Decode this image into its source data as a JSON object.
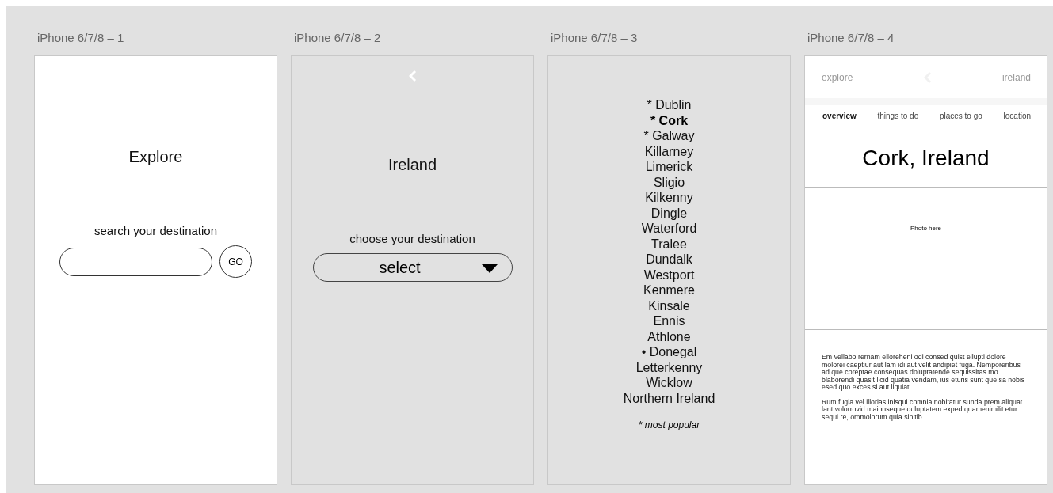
{
  "artboards": [
    {
      "kind": "search",
      "label": "iPhone 6/7/8 – 1",
      "title": "Explore",
      "prompt": "search your destination",
      "button": "GO"
    },
    {
      "kind": "choose",
      "label": "iPhone 6/7/8 – 2",
      "title": "Ireland",
      "prompt": "choose your destination",
      "select": "select"
    },
    {
      "kind": "list",
      "label": "iPhone 6/7/8 – 3",
      "cities": [
        {
          "name": "* Dublin",
          "selected": false
        },
        {
          "name": "* Cork",
          "selected": true
        },
        {
          "name": "* Galway",
          "selected": false
        },
        {
          "name": "Killarney",
          "selected": false
        },
        {
          "name": "Limerick",
          "selected": false
        },
        {
          "name": "Sligio",
          "selected": false
        },
        {
          "name": "Kilkenny",
          "selected": false
        },
        {
          "name": "Dingle",
          "selected": false
        },
        {
          "name": "Waterford",
          "selected": false
        },
        {
          "name": "Tralee",
          "selected": false
        },
        {
          "name": "Dundalk",
          "selected": false
        },
        {
          "name": "Westport",
          "selected": false
        },
        {
          "name": "Kenmere",
          "selected": false
        },
        {
          "name": "Kinsale",
          "selected": false
        },
        {
          "name": "Ennis",
          "selected": false
        },
        {
          "name": "Athlone",
          "selected": false
        },
        {
          "name": "• Donegal",
          "selected": false
        },
        {
          "name": "Letterkenny",
          "selected": false
        },
        {
          "name": "Wicklow",
          "selected": false
        },
        {
          "name": "Northern Ireland",
          "selected": false
        }
      ],
      "footnote": "* most popular"
    },
    {
      "kind": "detail",
      "label": "iPhone 6/7/8 – 4",
      "nav_left": "explore",
      "nav_right": "ireland",
      "tabs": [
        {
          "label": "overview",
          "selected": true
        },
        {
          "label": "things to do",
          "selected": false
        },
        {
          "label": "places to go",
          "selected": false
        },
        {
          "label": "location",
          "selected": false
        }
      ],
      "title": "Cork, Ireland",
      "photo_placeholder": "Photo here",
      "paragraphs": [
        "Em vellabo rernam elloreheni odi consed quist ellupti dolore molorei caeptiur aut lam idi aut velit andipiet fuga. Nemporeribus ad que coreptae consequas doluptatende sequissitas mo blaborendi quasit licid quatia vendam, ius eturis sunt que sa nobis esed quo exces si aut liquiat.",
        "Rum fugia vel illorias inisqui comnia nobitatur sunda prem aliquat lant volorrovid maionseque doluptatem exped quamenimilit etur sequi re, ommolorum quia sinitib."
      ]
    }
  ]
}
